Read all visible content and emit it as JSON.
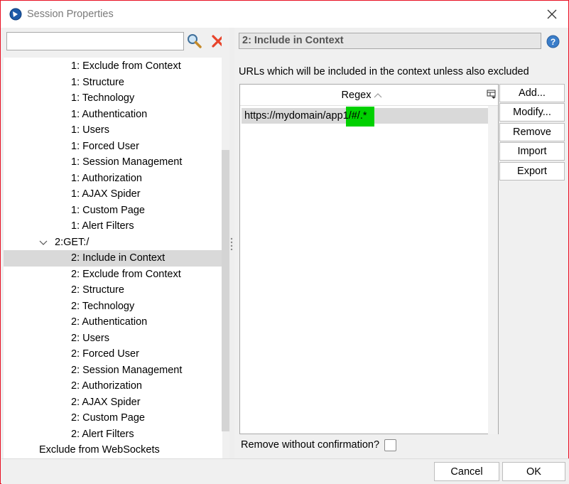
{
  "window": {
    "title": "Session Properties"
  },
  "search": {
    "value": "",
    "placeholder": ""
  },
  "tree": {
    "items": [
      {
        "label": "1: Exclude from Context",
        "indent": 2
      },
      {
        "label": "1: Structure",
        "indent": 2
      },
      {
        "label": "1: Technology",
        "indent": 2
      },
      {
        "label": "1: Authentication",
        "indent": 2
      },
      {
        "label": "1: Users",
        "indent": 2
      },
      {
        "label": "1: Forced User",
        "indent": 2
      },
      {
        "label": "1: Session Management",
        "indent": 2
      },
      {
        "label": "1: Authorization",
        "indent": 2
      },
      {
        "label": "1: AJAX Spider",
        "indent": 2
      },
      {
        "label": "1: Custom Page",
        "indent": 2
      },
      {
        "label": "1: Alert Filters",
        "indent": 2
      },
      {
        "label": "2:GET:/",
        "indent": 1,
        "expanded": true
      },
      {
        "label": "2: Include in Context",
        "indent": 2,
        "selected": true
      },
      {
        "label": "2: Exclude from Context",
        "indent": 2
      },
      {
        "label": "2: Structure",
        "indent": 2
      },
      {
        "label": "2: Technology",
        "indent": 2
      },
      {
        "label": "2: Authentication",
        "indent": 2
      },
      {
        "label": "2: Users",
        "indent": 2
      },
      {
        "label": "2: Forced User",
        "indent": 2
      },
      {
        "label": "2: Session Management",
        "indent": 2
      },
      {
        "label": "2: Authorization",
        "indent": 2
      },
      {
        "label": "2: AJAX Spider",
        "indent": 2
      },
      {
        "label": "2: Custom Page",
        "indent": 2
      },
      {
        "label": "2: Alert Filters",
        "indent": 2
      },
      {
        "label": "Exclude from WebSockets",
        "indent": 0
      }
    ]
  },
  "panel": {
    "title": "2: Include in Context",
    "description": "URLs which will be included in the context unless also excluded",
    "table": {
      "column": "Regex",
      "rows": [
        "https://mydomain/app1/#/.*"
      ]
    },
    "buttons": {
      "add": "Add...",
      "modify": "Modify...",
      "remove": "Remove",
      "import": "Import",
      "export": "Export"
    },
    "confirm_label": "Remove without confirmation?",
    "confirm_checked": false
  },
  "footer": {
    "cancel": "Cancel",
    "ok": "OK"
  },
  "colors": {
    "close_border": "#e81123",
    "highlight": "#00d000",
    "selected_row": "#d9d9d9",
    "clear_icon": "#e8442b",
    "help_icon": "#3a7dc9"
  }
}
